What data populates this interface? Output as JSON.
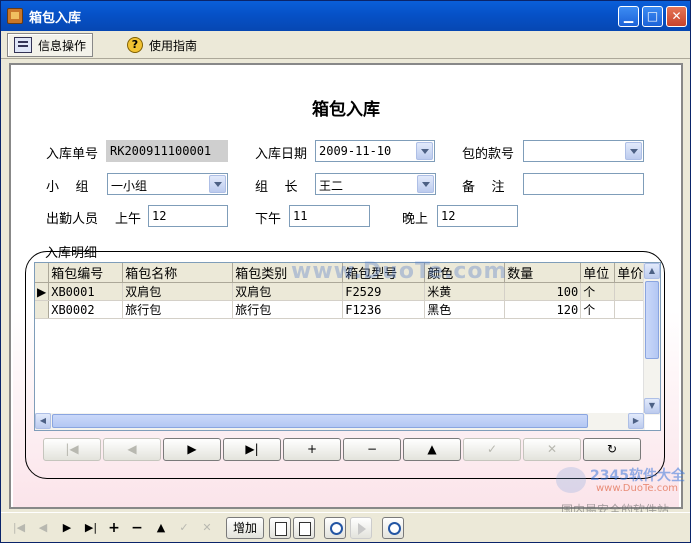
{
  "window": {
    "title": "箱包入库"
  },
  "toolbar": {
    "items": [
      {
        "label": "信息操作",
        "icon": "info-list-icon"
      },
      {
        "label": "使用指南",
        "icon": "help-icon"
      }
    ]
  },
  "form": {
    "title": "箱包入库",
    "order_no_label": "入库单号",
    "order_no": "RK200911100001",
    "date_label": "入库日期",
    "date": "2009-11-10",
    "style_no_label": "包的款号",
    "style_no": "",
    "group_label": "小    组",
    "group": "一小组",
    "leader_label": "组    长",
    "leader": "王二",
    "remark_label": "备    注",
    "remark": "",
    "attendance_label": "出勤人员",
    "morning_label": "上午",
    "morning": "12",
    "afternoon_label": "下午",
    "afternoon": "11",
    "evening_label": "晚上",
    "evening": "12"
  },
  "detail": {
    "title": "入库明细",
    "columns": [
      "箱包编号",
      "箱包名称",
      "箱包类别",
      "箱包型号",
      "颜色",
      "数量",
      "单位",
      "单价"
    ],
    "rows": [
      [
        "XB0001",
        "双肩包",
        "双肩包",
        "F2529",
        "米黄",
        "100",
        "个",
        ""
      ],
      [
        "XB0002",
        "旅行包",
        "旅行包",
        "F1236",
        "黑色",
        "120",
        "个",
        ""
      ]
    ],
    "selected_row": 0
  },
  "navigator": {
    "buttons": [
      "|◀",
      "◀",
      "▶",
      "▶|",
      "+",
      "−",
      "▲",
      "✓",
      "✕",
      "↻"
    ],
    "disabled": [
      0,
      1,
      7,
      8
    ]
  },
  "bottom": {
    "nav": [
      "|◀",
      "◀",
      "▶",
      "▶|",
      "+",
      "−",
      "▲",
      "✓",
      "✕"
    ],
    "nav_disabled": [
      0,
      1,
      7,
      8
    ],
    "add_label": "增加"
  },
  "watermarks": {
    "site": "www.DuoTe.com",
    "brand": "2345软件大全",
    "brand_url": "www.DuoTe.com",
    "slogan": "国内最安全的软件站"
  },
  "colors": {
    "titlebar": "#0651c7",
    "form_gradient_end": "#fbe4ea",
    "group_border": "#000000"
  }
}
